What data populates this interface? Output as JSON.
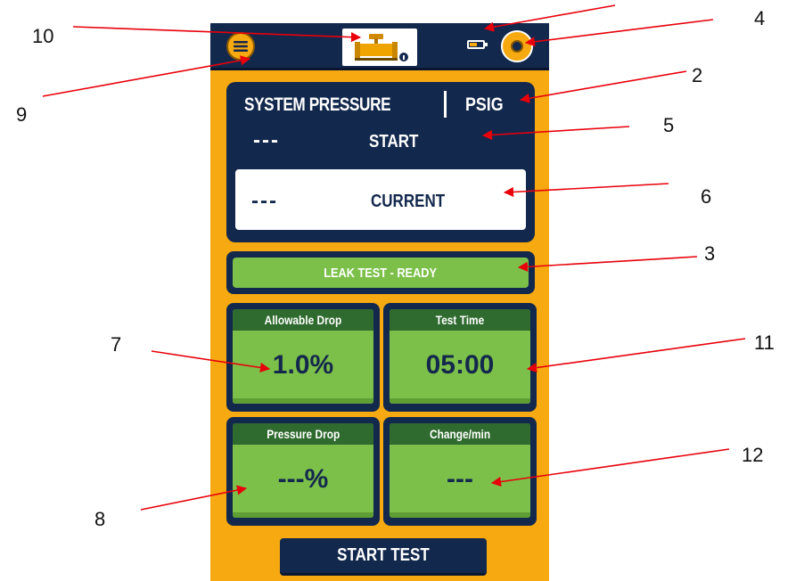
{
  "callouts": {
    "c10": "10",
    "c4": "4",
    "c9": "9",
    "c2": "2",
    "c5": "5",
    "c6": "6",
    "c3": "3",
    "c7": "7",
    "c11": "11",
    "c12": "12",
    "c8": "8"
  },
  "colors": {
    "background": "#f6a910",
    "navy": "#13284d",
    "green": "#7cc04a",
    "green_header": "#2f6a2f",
    "arrow": "#e8000b"
  },
  "topbar": {
    "menu_icon": "hamburger-menu-icon",
    "logo_icon": "pipe-valve-logo-icon",
    "battery_icon": "battery-icon",
    "settings_icon": "gear-icon"
  },
  "pressure": {
    "title": "SYSTEM PRESSURE",
    "unit": "PSIG",
    "start_value": "---",
    "start_label": "START",
    "current_value": "---",
    "current_label": "CURRENT"
  },
  "status": {
    "text": "LEAK TEST - READY"
  },
  "tiles": {
    "allowable_drop": {
      "label": "Allowable Drop",
      "value": "1.0%"
    },
    "test_time": {
      "label": "Test Time",
      "value": "05:00"
    },
    "pressure_drop": {
      "label": "Pressure Drop",
      "value": "---%"
    },
    "change_per_min": {
      "label": "Change/min",
      "value": "---"
    }
  },
  "buttons": {
    "start_test": "START TEST"
  }
}
